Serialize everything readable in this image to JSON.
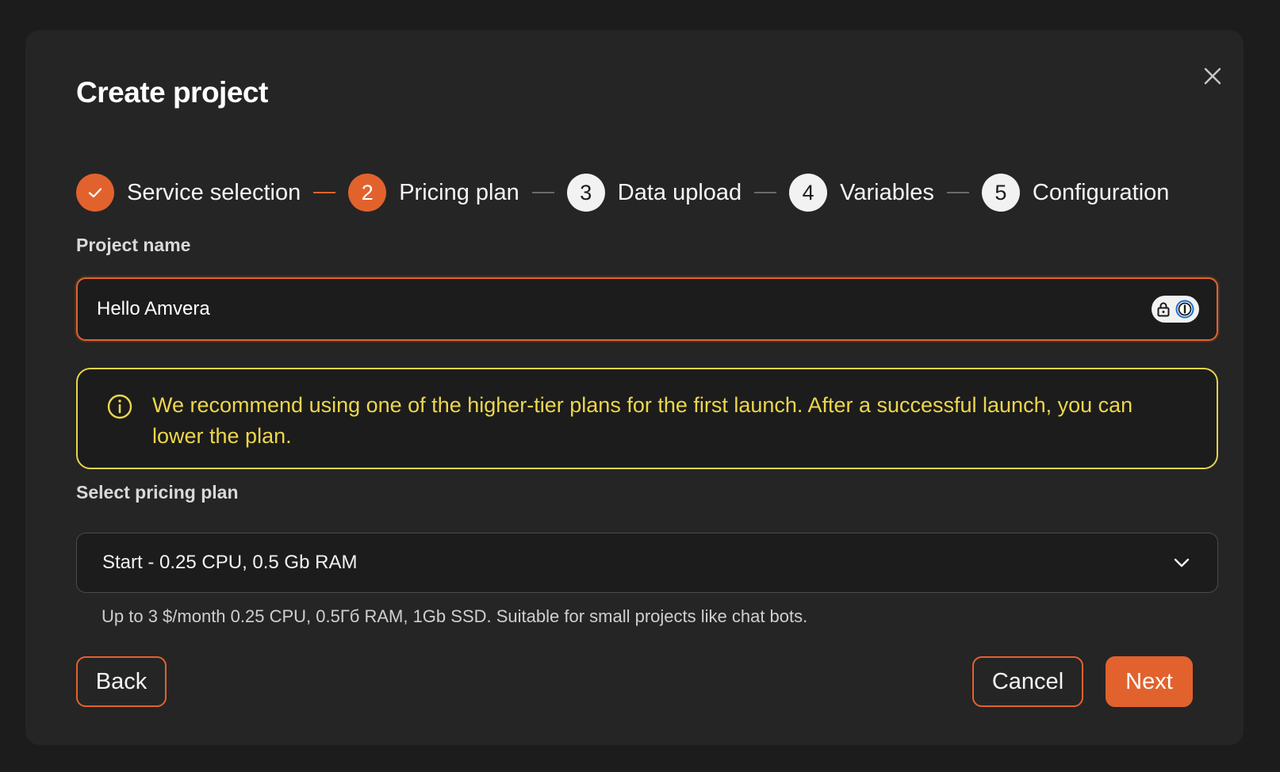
{
  "dialog": {
    "title": "Create project"
  },
  "stepper": {
    "steps": [
      {
        "number": "1",
        "label": "Service selection",
        "state": "done"
      },
      {
        "number": "2",
        "label": "Pricing plan",
        "state": "active"
      },
      {
        "number": "3",
        "label": "Data upload",
        "state": "pending"
      },
      {
        "number": "4",
        "label": "Variables",
        "state": "pending"
      },
      {
        "number": "5",
        "label": "Configuration",
        "state": "pending"
      }
    ]
  },
  "form": {
    "project_name_label": "Project name",
    "project_name_value": "Hello Amvera",
    "alert_text": "We recommend using one of the higher-tier plans for the first launch. After a successful launch, you can lower the plan.",
    "plan_label": "Select pricing plan",
    "plan_selected": "Start - 0.25 CPU, 0.5 Gb RAM",
    "plan_description": "Up to 3 $/month 0.25 CPU, 0.5Гб RAM, 1Gb SSD. Suitable for small projects like chat bots."
  },
  "buttons": {
    "back": "Back",
    "cancel": "Cancel",
    "next": "Next"
  },
  "icons": {
    "close": "close-icon",
    "check": "check-icon",
    "info": "info-icon",
    "chevron": "chevron-down-icon",
    "password_manager": "password-manager-icon"
  },
  "colors": {
    "accent": "#e2622d",
    "warning": "#ecd64c",
    "modal_bg": "#252525",
    "input_bg": "#1c1c1c"
  }
}
